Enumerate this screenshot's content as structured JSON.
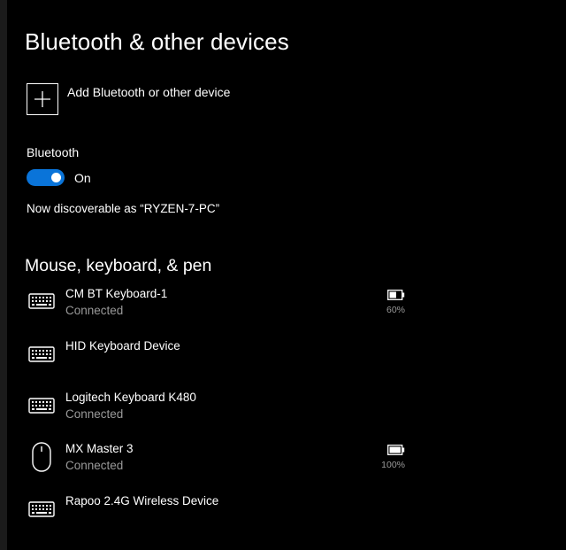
{
  "page": {
    "title": "Bluetooth & other devices"
  },
  "add_device": {
    "label": "Add Bluetooth or other device",
    "icon": "plus-icon"
  },
  "bluetooth": {
    "label": "Bluetooth",
    "toggle_state": "On",
    "enabled": true,
    "discoverable_text": "Now discoverable as “RYZEN-7-PC”"
  },
  "section": {
    "title": "Mouse, keyboard, & pen"
  },
  "devices": [
    {
      "name": "CM BT Keyboard-1",
      "status": "Connected",
      "icon": "keyboard-icon",
      "battery_pct": "60%",
      "battery_level": 0.6
    },
    {
      "name": "HID Keyboard Device",
      "status": "",
      "icon": "keyboard-icon",
      "battery_pct": "",
      "battery_level": null
    },
    {
      "name": "Logitech Keyboard K480",
      "status": "Connected",
      "icon": "keyboard-icon",
      "battery_pct": "",
      "battery_level": null
    },
    {
      "name": "MX Master 3",
      "status": "Connected",
      "icon": "mouse-icon",
      "battery_pct": "100%",
      "battery_level": 1.0
    },
    {
      "name": "Rapoo 2.4G Wireless Device",
      "status": "",
      "icon": "keyboard-icon",
      "battery_pct": "",
      "battery_level": null
    }
  ],
  "colors": {
    "background": "#000000",
    "accent": "#0a74d9",
    "text": "#ffffff",
    "secondary_text": "#9a9a9a"
  }
}
